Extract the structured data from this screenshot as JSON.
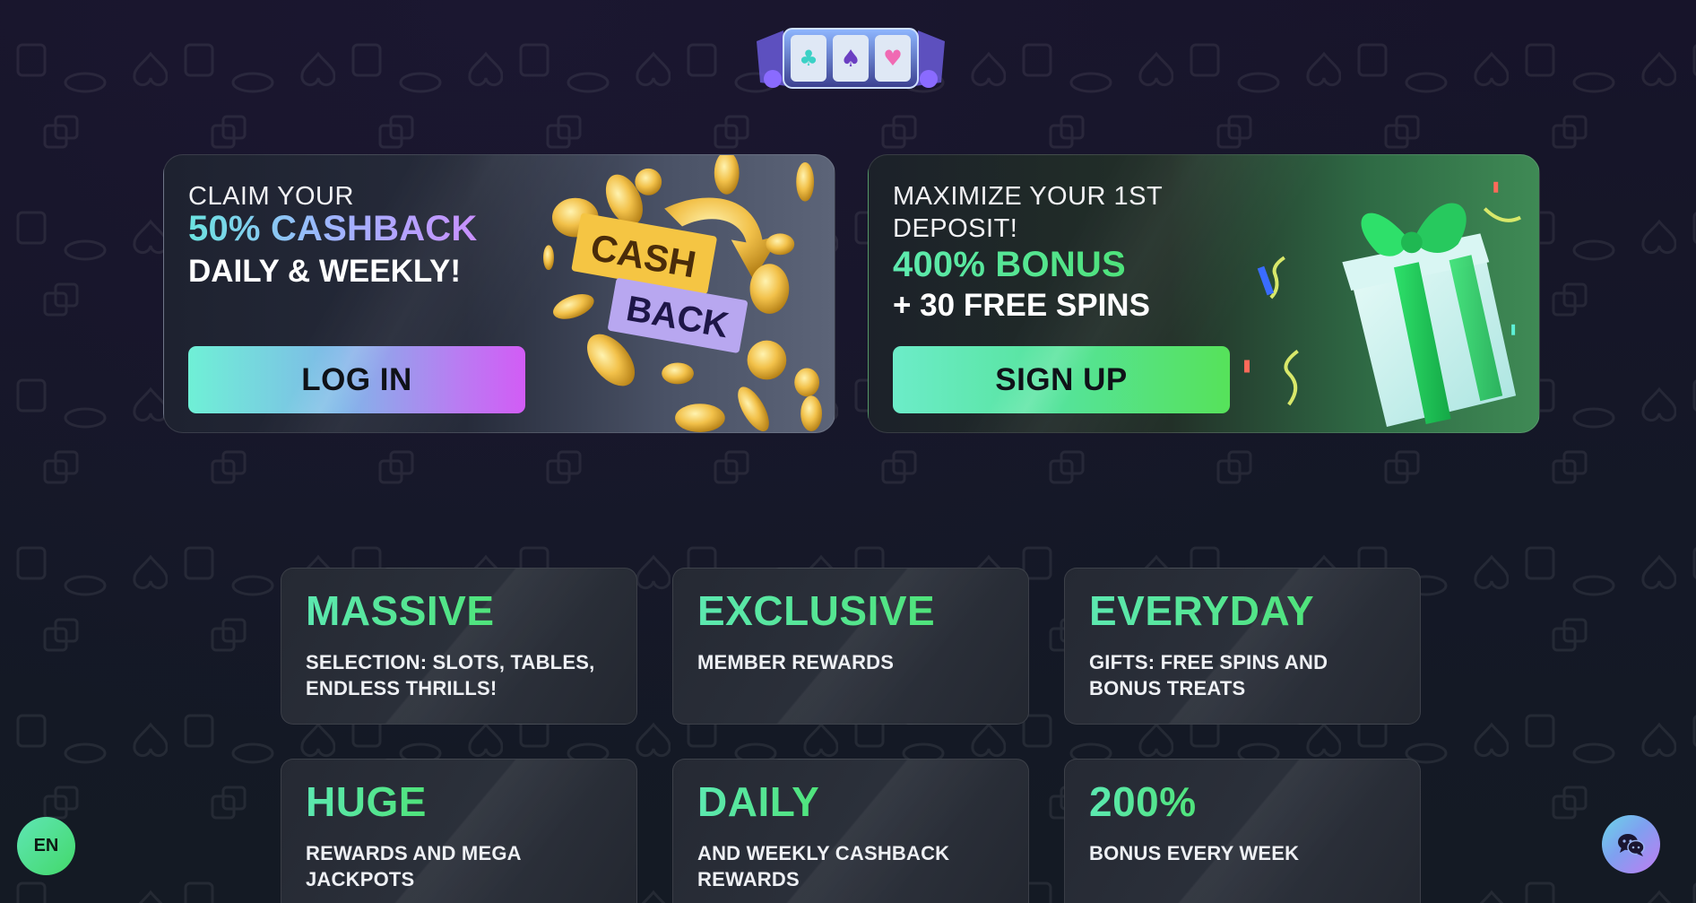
{
  "promos": {
    "cashback": {
      "line1": "CLAIM YOUR",
      "headline": "50% CASHBACK",
      "subline": "DAILY & WEEKLY!",
      "button_label": "LOG IN",
      "art_text_top": "CASH",
      "art_text_bottom": "BACK"
    },
    "deposit": {
      "line1": "MAXIMIZE YOUR 1ST DEPOSIT!",
      "headline": "400% BONUS",
      "subline": "+ 30 FREE SPINS",
      "button_label": "SIGN UP"
    }
  },
  "features": [
    {
      "title": "MASSIVE",
      "desc": "SELECTION: SLOTS, TABLES, ENDLESS THRILLS!"
    },
    {
      "title": "EXCLUSIVE",
      "desc": "MEMBER REWARDS"
    },
    {
      "title": "EVERYDAY",
      "desc": "GIFTS: FREE SPINS AND BONUS TREATS"
    },
    {
      "title": "HUGE",
      "desc": "REWARDS AND MEGA JACKPOTS"
    },
    {
      "title": "DAILY",
      "desc": "AND WEEKLY CASHBACK REWARDS"
    },
    {
      "title": "200%",
      "desc": "BONUS EVERY WEEK"
    }
  ],
  "language": {
    "label": "EN"
  },
  "icons": {
    "logo": "slot-machine-logo-icon",
    "chat": "chat-icon"
  },
  "colors": {
    "background": "#14141f",
    "accent_green": "#4ee27a",
    "accent_teal": "#5ce8b0",
    "accent_purple": "#c990ff"
  }
}
